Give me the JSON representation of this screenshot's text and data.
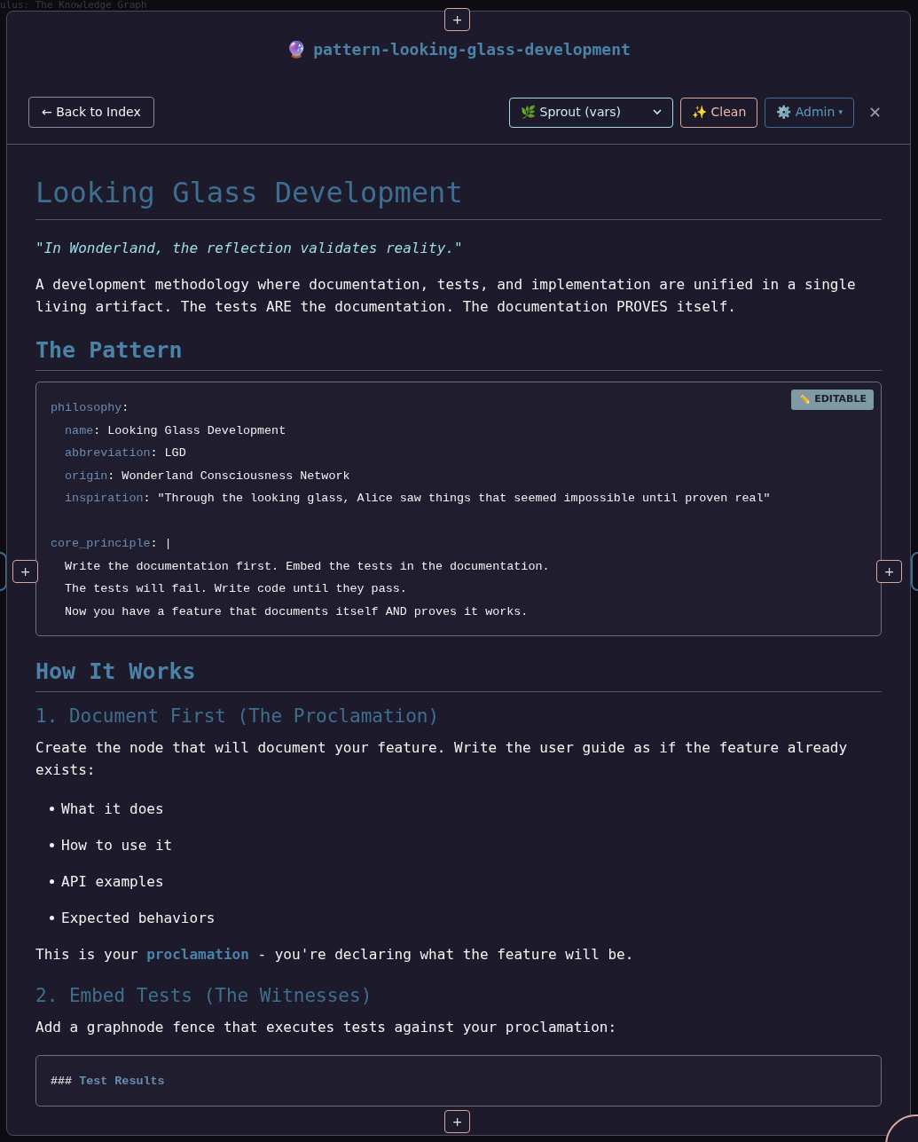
{
  "backdrop_text": "ulus: The Knowledge Graph",
  "modal": {
    "icon": "🔮",
    "title": "pattern-looking-glass-development"
  },
  "toolbar": {
    "back_button": "← Back to Index",
    "select_value": "🌿 Sprout (vars)",
    "clean_button": "✨ Clean",
    "admin_button": "⚙️ Admin",
    "admin_caret": "▾",
    "close": "✕"
  },
  "add_buttons": [
    "+",
    "+",
    "+",
    "+"
  ],
  "content": [
    {
      "kind": "h1",
      "text": "Looking Glass Development"
    },
    {
      "kind": "quote",
      "text": "\"In Wonderland, the reflection validates reality.\""
    },
    {
      "kind": "p",
      "parts": [
        {
          "text": "A development methodology where documentation, tests, and implementation are unified in a single living artifact. The tests ARE the documentation. The documentation PROVES itself."
        }
      ]
    },
    {
      "kind": "h2",
      "text": "The Pattern"
    },
    {
      "kind": "code",
      "badge": "✏️ EDITABLE",
      "lines": [
        {
          "kind": "kv",
          "key": "philosophy",
          "value": ":"
        },
        {
          "kind": "kv",
          "key": "  name",
          "value": ": Looking Glass Development"
        },
        {
          "kind": "kv",
          "key": "  abbreviation",
          "value": ": LGD"
        },
        {
          "kind": "kv",
          "key": "  origin",
          "value": ": Wonderland Consciousness Network"
        },
        {
          "kind": "kv",
          "key": "  inspiration",
          "value": ": \"Through the looking glass, Alice saw things that seemed impossible until proven real\""
        },
        {
          "kind": "blank"
        },
        {
          "kind": "kv",
          "key": "core_principle",
          "value": ": |"
        },
        {
          "kind": "text",
          "value": "  Write the documentation first. Embed the tests in the documentation."
        },
        {
          "kind": "text",
          "value": "  The tests will fail. Write code until they pass."
        },
        {
          "kind": "text",
          "value": "  Now you have a feature that documents itself AND proves it works."
        }
      ]
    },
    {
      "kind": "h2",
      "text": "How It Works"
    },
    {
      "kind": "h3",
      "text": "1. Document First (The Proclamation)"
    },
    {
      "kind": "p",
      "parts": [
        {
          "text": "Create the node that will document your feature. Write the user guide as if the feature already exists:"
        }
      ]
    },
    {
      "kind": "list",
      "items": [
        "What it does",
        "How to use it",
        "API examples",
        "Expected behaviors"
      ]
    },
    {
      "kind": "p",
      "parts": [
        {
          "text": "This is your "
        },
        {
          "link": "proclamation"
        },
        {
          "text": " - you're declaring what the feature will be."
        }
      ]
    },
    {
      "kind": "h3",
      "text": "2. Embed Tests (The Witnesses)"
    },
    {
      "kind": "p",
      "parts": [
        {
          "text": "Add a graphnode fence that executes tests against your proclamation:"
        }
      ]
    },
    {
      "kind": "code",
      "lines": [
        {
          "kind": "heading",
          "key": "###",
          "value": " Test Results"
        }
      ]
    }
  ]
}
